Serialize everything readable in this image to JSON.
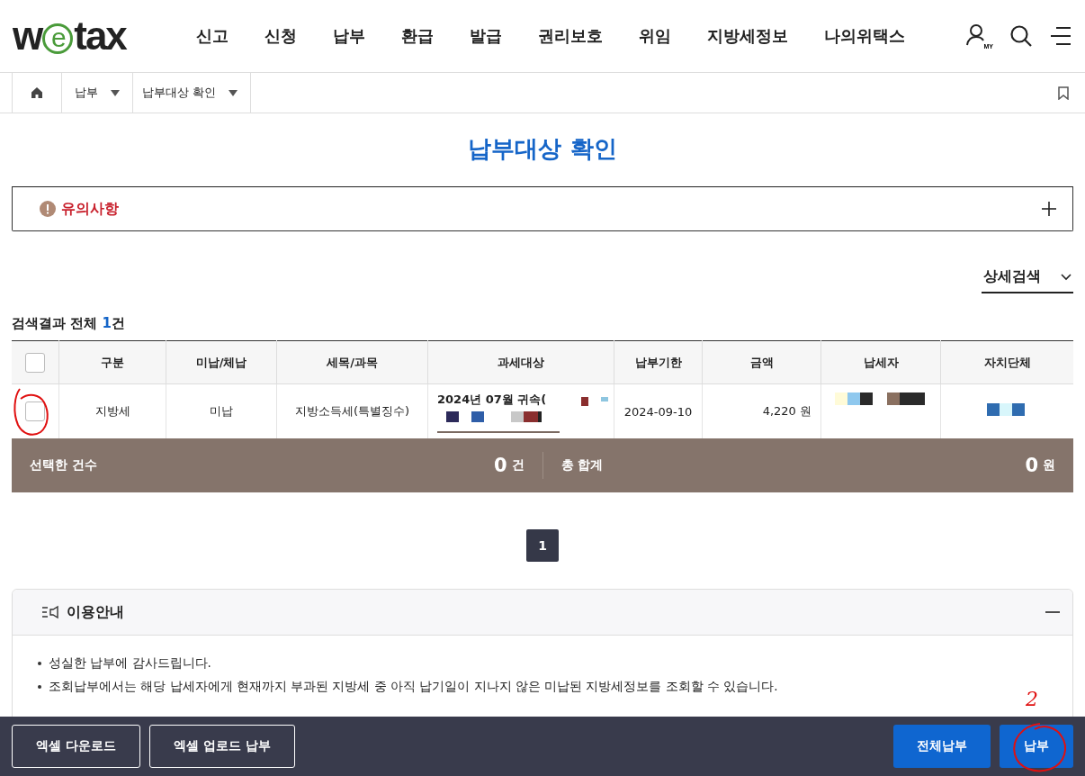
{
  "header": {
    "logo": "wetax",
    "nav": [
      "신고",
      "신청",
      "납부",
      "환급",
      "발급",
      "권리보호",
      "위임",
      "지방세정보",
      "나의위택스"
    ],
    "my_label": "MY"
  },
  "breadcrumb": [
    {
      "label": "납부"
    },
    {
      "label": "납부대상 확인"
    }
  ],
  "page_title": "납부대상 확인",
  "notice": {
    "label": "유의사항",
    "expanded": false
  },
  "detail_search": {
    "label": "상세검색",
    "expanded": false
  },
  "result": {
    "prefix": "검색결과 전체 ",
    "count": "1",
    "suffix": "건"
  },
  "table": {
    "all_checked": false,
    "columns": [
      "구분",
      "미납/체납",
      "세목/과목",
      "과세대상",
      "납부기한",
      "금액",
      "납세자",
      "자치단체"
    ],
    "rows": [
      {
        "checked": false,
        "cells": [
          "지방세",
          "미납",
          "지방소득세(특별징수)",
          "2024년 07월 귀속(",
          "2024-09-10",
          "4,220 원",
          "",
          ""
        ]
      }
    ]
  },
  "summary": {
    "count_label": "선택한 건수",
    "count": "0",
    "count_unit": "건",
    "total_label": "총 합계",
    "total": "0",
    "total_unit": "원"
  },
  "pagination": [
    {
      "label": "1",
      "selected": true
    }
  ],
  "guide": {
    "title": "이용안내",
    "expanded": true,
    "items": [
      "성실한 납부에 감사드립니다.",
      "조회납부에서는 해당 납세자에게 현재까지 부과된 지방세 중 아직 납기일이 지나지 않은 미납된 지방세정보를 조회할 수 있습니다."
    ]
  },
  "bottom_bar": {
    "left": [
      "엑셀 다운로드",
      "엑셀 업로드 납부"
    ],
    "right": [
      "전체납부",
      "납부"
    ]
  },
  "annotation_mark": "2"
}
